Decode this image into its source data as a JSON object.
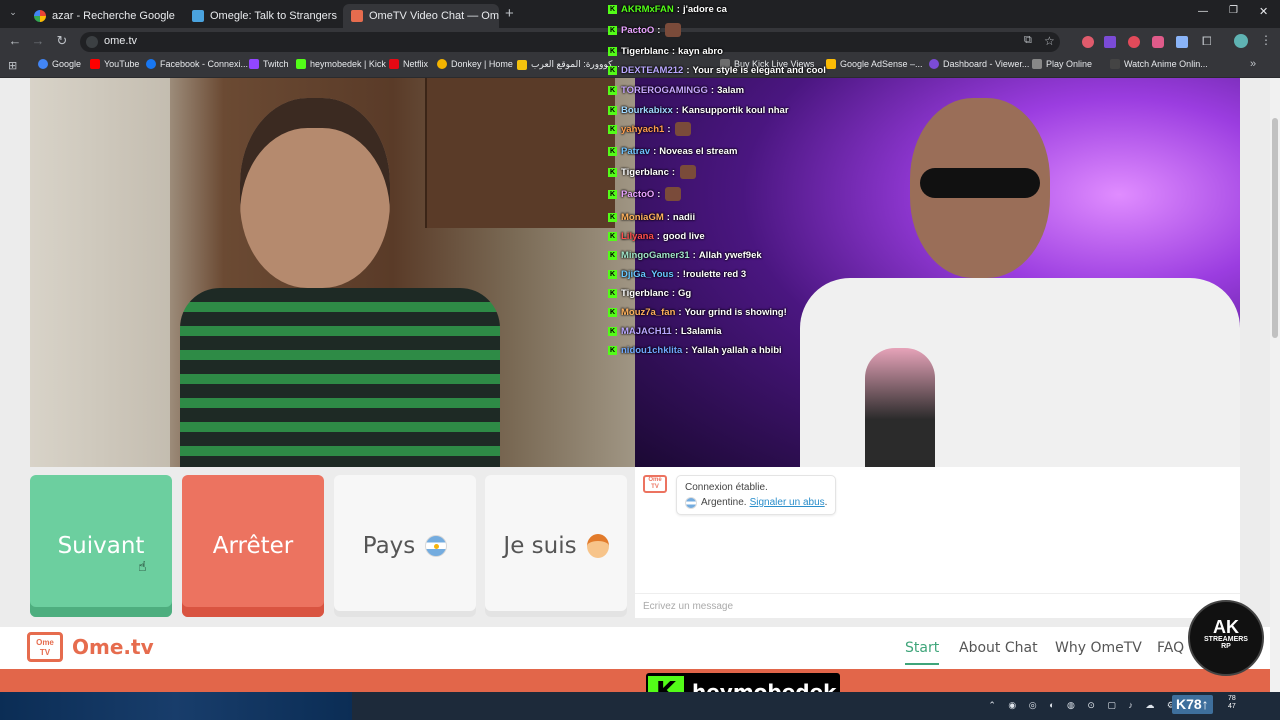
{
  "tabs": [
    {
      "title": "azar - Recherche Google",
      "close": "✕"
    },
    {
      "title": "Omegle: Talk to Strangers v",
      "close": "✕"
    },
    {
      "title": "OmeTV Video Chat — Ome",
      "close": "✕"
    },
    {
      "new": "+"
    }
  ],
  "window_controls": {
    "minimize": "—",
    "maximize": "❐",
    "close": "✕"
  },
  "address": {
    "url": "ome.tv"
  },
  "bookmarks": [
    "Google",
    "YouTube",
    "Facebook - Connexi...",
    "Twitch",
    "heymobedek | Kick",
    "Netflix",
    "Donkey | Home",
    "كووورة: الموقع العرب...",
    "Buy Kick Live Views",
    "Google AdSense –...",
    "Dashboard - Viewer...",
    "Play Online",
    "Watch Anime Onlin..."
  ],
  "stream_chat": [
    {
      "user": "AKRMxFAN",
      "color": "#53fc18",
      "text": "j'adore ca"
    },
    {
      "user": "PactoO",
      "color": "#e9a3ff",
      "text": ""
    },
    {
      "user": "Tigerblanc",
      "color": "#ffffff",
      "text": "kayn abro"
    },
    {
      "user": "DEXTEAM212",
      "color": "#b9a7ff",
      "text": "Your style is elegant and cool"
    },
    {
      "user": "TOREROGAMINGG",
      "color": "#c7a6ff",
      "text": "3alam"
    },
    {
      "user": "Bourkabixx",
      "color": "#9fd8ff",
      "text": "Kansupportik koul nhar"
    },
    {
      "user": "yahyach1",
      "color": "#ff9d4d",
      "text": ""
    },
    {
      "user": "Patrav",
      "color": "#6fc3ff",
      "text": "Noveas el stream"
    },
    {
      "user": "Tigerblanc",
      "color": "#ffffff",
      "text": ""
    },
    {
      "user": "PactoO",
      "color": "#e9a3ff",
      "text": ""
    },
    {
      "user": "MoniaGM",
      "color": "#ffb15c",
      "text": "nadii"
    },
    {
      "user": "Lilyana",
      "color": "#ff4d4d",
      "text": "good live"
    },
    {
      "user": "MingoGamer31",
      "color": "#9fe3c6",
      "text": "Allah ywef9ek"
    },
    {
      "user": "DjiGa_Yous",
      "color": "#67c7ff",
      "text": "!roulette red 3"
    },
    {
      "user": "Tigerblanc",
      "color": "#ffffff",
      "text": "Gg"
    },
    {
      "user": "Mouz7a_fan",
      "color": "#ffb15c",
      "text": "Your grind is showing!"
    },
    {
      "user": "MAJACH11",
      "color": "#b9a7ff",
      "text": "L3alamia"
    },
    {
      "user": "nidou1chklita",
      "color": "#6fa8ff",
      "text": "Yallah yallah a hbibi"
    }
  ],
  "buttons": {
    "next": "Suivant",
    "stop": "Arrêter",
    "country": "Pays",
    "iam": "Je suis"
  },
  "chat_box": {
    "status": "Connexion établie.",
    "country": "Argentine.",
    "report": "Signaler un abus",
    "period": ".",
    "placeholder": "Écrivez un message",
    "avatar_text": "Ome TV"
  },
  "site_nav": {
    "logo_box": "Ome TV",
    "logo_text": "Ome.tv",
    "links": [
      "Start",
      "About Chat",
      "Why OmeTV",
      "FAQ"
    ]
  },
  "kick_overlay": {
    "logo": "K",
    "name": "heymobedek"
  },
  "ak_badge": {
    "line1": "AK",
    "line2": "STREAMERS",
    "line3": "RP"
  },
  "taskbar": {
    "kick_count": "K78↑",
    "clock_line1": "78",
    "clock_line2": "47"
  },
  "colors": {
    "next": "#6ccf9f",
    "stop": "#ec7360",
    "accent_nav": "#3fa57a",
    "brand": "#e66c4e",
    "kick": "#53fc18"
  }
}
